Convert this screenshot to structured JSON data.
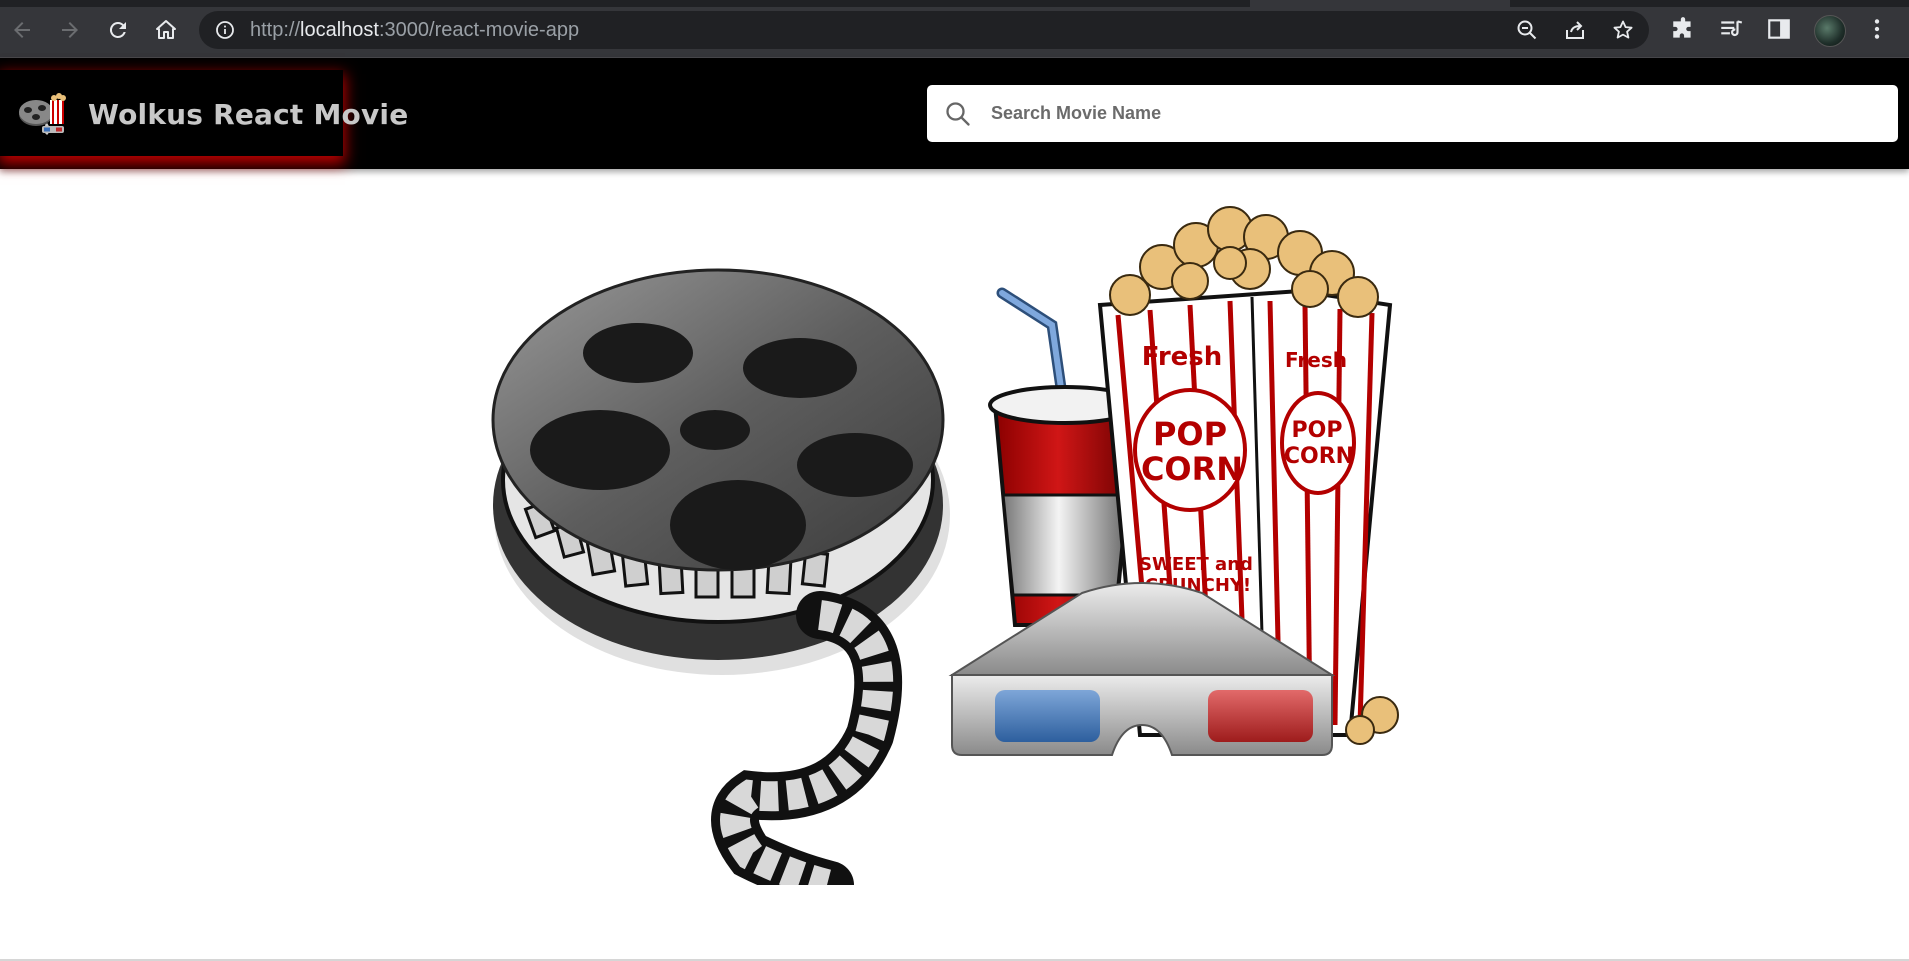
{
  "browser": {
    "url_scheme": "http://",
    "url_host": "localhost",
    "url_path": ":3000/react-movie-app",
    "icons": [
      "back-icon",
      "forward-icon",
      "reload-icon",
      "home-icon",
      "info-icon",
      "zoom-out-icon",
      "share-icon",
      "bookmark-star-icon",
      "extensions-icon",
      "media-queue-icon",
      "side-panel-icon",
      "profile-avatar",
      "menu-icon"
    ]
  },
  "app": {
    "title": "Wolkus React Movie",
    "search_placeholder": "Search Movie Name"
  },
  "hero": {
    "popcorn_label_fresh": "Fresh",
    "popcorn_label_pop": "POP",
    "popcorn_label_corn": "CORN",
    "popcorn_label_sweet": "SWEET and",
    "popcorn_label_crunchy": "CRUNCHY!"
  },
  "colors": {
    "header_bg": "#000000",
    "brand_glow": "#dc0000",
    "browser_bg": "#35363a"
  }
}
